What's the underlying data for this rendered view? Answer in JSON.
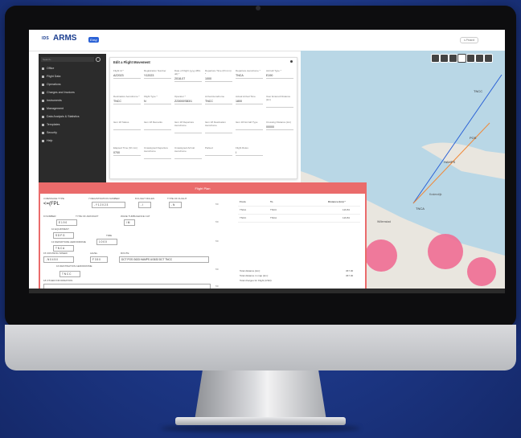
{
  "header": {
    "logo_text": "IDS",
    "app_name": "ARMS",
    "app_tag": "Easy",
    "user": "s.Pinardi"
  },
  "sidebar": {
    "search_placeholder": "Search...",
    "items": [
      {
        "label": "Office"
      },
      {
        "label": "Flight Data"
      },
      {
        "label": "Operations"
      },
      {
        "label": "Charges and Invoices"
      },
      {
        "label": "Instruments"
      },
      {
        "label": "Management"
      },
      {
        "label": "Data Analysis & Statistics"
      },
      {
        "label": "Templates"
      },
      {
        "label": "Security"
      },
      {
        "label": "Help"
      }
    ]
  },
  "edit_panel": {
    "title": "Edit a Flight Movement",
    "fields": [
      {
        "label": "Flight Id *",
        "value": "AZ2023"
      },
      {
        "label": "Registration Number",
        "value": "Y12023"
      },
      {
        "label": "Date of Flight (yyyy-MM-dd) *",
        "value": "2018-07"
      },
      {
        "label": "Departure Time (hh:mm) *",
        "value": "1000"
      },
      {
        "label": "Departure Aerodrome *",
        "value": "TNCA"
      },
      {
        "label": "Aircraft Type *",
        "value": "E190"
      },
      {
        "label": "Destination Aerodrome *",
        "value": "TNCC"
      },
      {
        "label": "Flight Type *",
        "value": "N"
      },
      {
        "label": "Operator *",
        "value": "Z23000SB3/1"
      },
      {
        "label": "Arrival Aerodrome",
        "value": "TNCC"
      },
      {
        "label": "Actual Arrival Time",
        "value": "1800"
      },
      {
        "label": "User Entered Distance (km)",
        "value": ""
      },
      {
        "label": "Item 18 Status",
        "value": ""
      },
      {
        "label": "Item 18 Remarks",
        "value": ""
      },
      {
        "label": "Item 18 Departure Aerodrome",
        "value": ""
      },
      {
        "label": "Item 18 Destination Aerodrome",
        "value": ""
      },
      {
        "label": "Item 18 Aircraft Type",
        "value": ""
      },
      {
        "label": "Crossing Distance (km)",
        "value": "00000"
      },
      {
        "label": "Elapsed Time (hh:mm)",
        "value": "0700"
      },
      {
        "label": "Unassigned Departure Aerodrome",
        "value": ""
      },
      {
        "label": "Unassigned Arrival Aerodrome",
        "value": ""
      },
      {
        "label": "Parked",
        "value": ""
      },
      {
        "label": "Flight Rules",
        "value": "I"
      }
    ]
  },
  "flight_plan": {
    "title": "Flight Plan",
    "message_type_label": "3 MESSAGE TYPE",
    "message_type_value": "<=(FPL",
    "aircraft_id_label": "7 REGISTRATION NUMBER",
    "aircraft_id_value": "- Y 1 2 0 2 3",
    "flight_rules_label": "8 FLIGHT RULES",
    "flight_rules_value": "- I",
    "type_of_flight_label": "TYPE OF FLIGHT",
    "type_of_flight_value": "- N",
    "number_label": "9 NUMBER",
    "number_value": "E 1 9 0",
    "aircraft_type_label": "TYPE OF AIRCRAFT",
    "wake_label": "WAKE TURBULENCE CAT",
    "wake_value": "/ M",
    "equipment_label": "10 EQUIPMENT",
    "equipment_value": "S D F G",
    "dep_ad_label": "13 DEPARTURE AERODROME",
    "dep_ad_value": "T N C A",
    "time_label": "TIME",
    "time_value": "1 0 0 0",
    "cruising_label": "15 CRUISING SPEED",
    "cruising_value": "- N 0 4 5 0",
    "level_label": "LEVEL",
    "level_value": "F 3 5 0",
    "route_label": "ROUTE",
    "route_value": "DCT POS G633 HAMPS UG633 DCT TNCC",
    "dest_ad_label": "16 DESTINATION AERODROME",
    "dest_ad_value": "T N C C",
    "other_info_label": "18 OTHER INFORMATION",
    "arrow": "<=",
    "table_headers": [
      "From",
      "To",
      "Distance (km) *"
    ],
    "table_rows": [
      {
        "from": "TNCA",
        "to": "TNCC",
        "dist": "116.84"
      },
      {
        "from": "TNCC",
        "to": "TNCA",
        "dist": "116.84"
      }
    ],
    "summary": [
      {
        "label": "Total distance (km):",
        "value": "367.00"
      },
      {
        "label": "Total distance in map (km):",
        "value": "367.00"
      },
      {
        "label": "Total charges for Flight (USD):",
        "value": "0.00"
      }
    ]
  },
  "map": {
    "labels": [
      "TNCC",
      "TNCA",
      "POS",
      "HAMPS",
      "Kralendijk",
      "Willemstad"
    ]
  },
  "colors": {
    "accent": "#ea6b6b",
    "brand": "#1a3d8f",
    "sidebar": "#2b2b2b",
    "background": "#1e3a8c"
  }
}
